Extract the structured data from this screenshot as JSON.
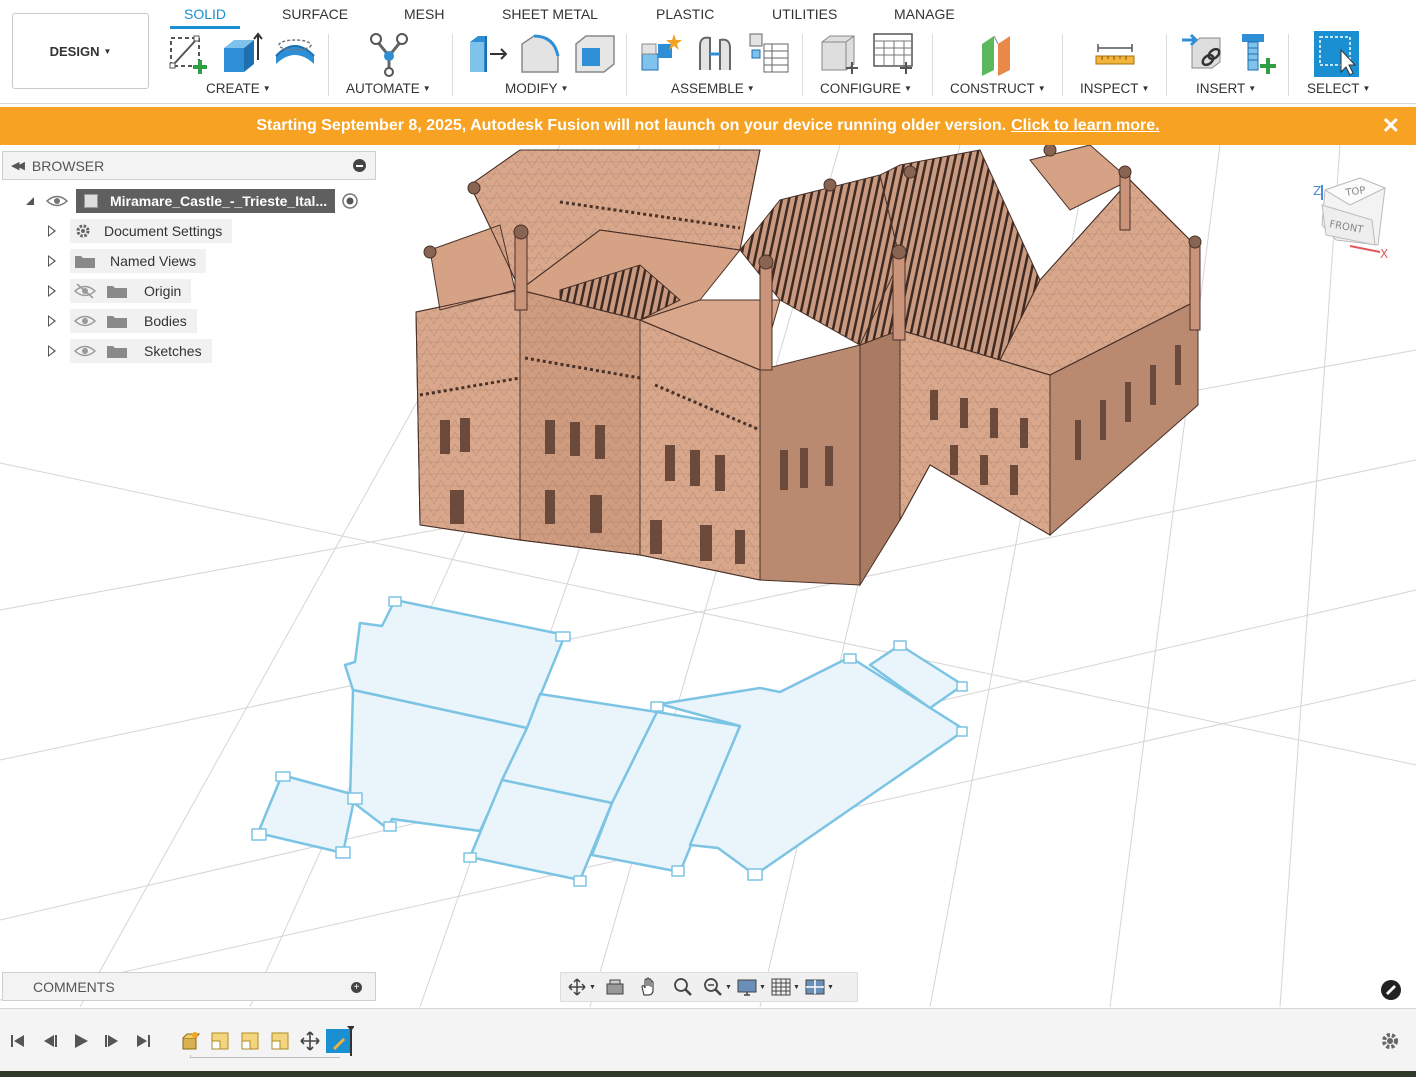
{
  "workspace": {
    "label": "DESIGN"
  },
  "tabs": [
    {
      "label": "SOLID",
      "active": true
    },
    {
      "label": "SURFACE"
    },
    {
      "label": "MESH"
    },
    {
      "label": "SHEET METAL"
    },
    {
      "label": "PLASTIC"
    },
    {
      "label": "UTILITIES"
    },
    {
      "label": "MANAGE"
    }
  ],
  "groups": {
    "create": "CREATE",
    "automate": "AUTOMATE",
    "modify": "MODIFY",
    "assemble": "ASSEMBLE",
    "configure": "CONFIGURE",
    "construct": "CONSTRUCT",
    "inspect": "INSPECT",
    "insert": "INSERT",
    "select": "SELECT"
  },
  "banner": {
    "text": "Starting September 8, 2025, Autodesk Fusion will not launch on your device running older version.",
    "link": "Click to learn more.",
    "close": "✕",
    "color": "#f7a223"
  },
  "browser": {
    "title": "BROWSER",
    "root": "Miramare_Castle_-_Trieste_Ital...",
    "items": [
      {
        "label": "Document Settings",
        "icon": "gear-icon"
      },
      {
        "label": "Named Views",
        "icon": "folder-icon"
      },
      {
        "label": "Origin",
        "icon": "folder-icon",
        "visibility": "hidden"
      },
      {
        "label": "Bodies",
        "icon": "folder-icon",
        "visibility": "visible"
      },
      {
        "label": "Sketches",
        "icon": "folder-icon",
        "visibility": "visible"
      }
    ]
  },
  "viewcube": {
    "top": "TOP",
    "front": "FRONT",
    "z": "Z",
    "x": "X"
  },
  "comments": {
    "title": "COMMENTS"
  },
  "colors": {
    "accent": "#1a8fd1",
    "model": "#d9a88c",
    "sketch": "#7cc4e4"
  }
}
